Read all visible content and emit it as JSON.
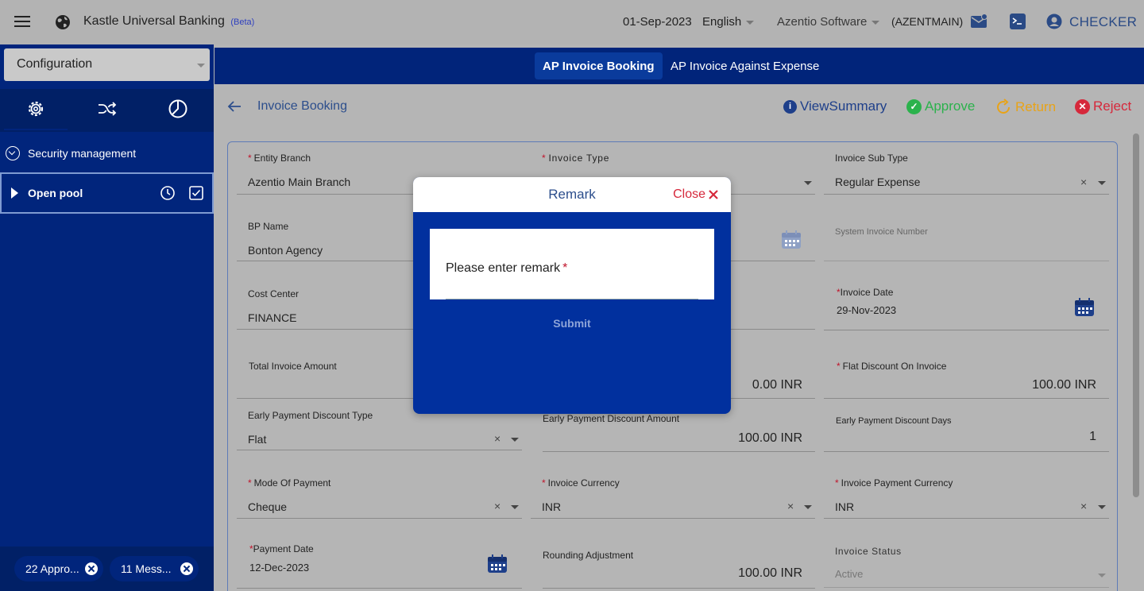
{
  "header": {
    "app_title": "Kastle Universal Banking",
    "beta": "(Beta)",
    "date": "01-Sep-2023",
    "language": "English",
    "organization": "Azentio Software",
    "org_code": "(AZENTMAIN)",
    "role": "CHECKER",
    "icons": [
      "menu-icon",
      "globe-icon",
      "mail-icon",
      "terminal-icon",
      "user-icon"
    ]
  },
  "sidebar": {
    "module_select": "Configuration",
    "tabs": [
      "gear-icon",
      "shuffle-icon",
      "pie-chart-icon"
    ],
    "tree": [
      {
        "label": "Security management",
        "icon": "circle-chevron-down-icon"
      },
      {
        "label": "Open pool",
        "icon": "triangle-right-icon"
      }
    ],
    "footer_chips": [
      {
        "label": "22 Appro..."
      },
      {
        "label": "11 Mess..."
      }
    ]
  },
  "tabs": [
    {
      "label": "AP Invoice Booking",
      "active": true
    },
    {
      "label": "AP Invoice Against Expense",
      "active": false
    }
  ],
  "page": {
    "title": "Invoice Booking",
    "actions": {
      "view_summary": "ViewSummary",
      "approve": "Approve",
      "return": "Return",
      "reject": "Reject"
    }
  },
  "form": {
    "entity_branch": {
      "label": "Entity Branch",
      "value": "Azentio Main Branch"
    },
    "invoice_type": {
      "label": "Invoice Type",
      "value": ""
    },
    "invoice_sub_type": {
      "label": "Invoice Sub Type",
      "value": "Regular Expense"
    },
    "bp_name": {
      "label": "BP Name",
      "value": "Bonton Agency"
    },
    "system_invoice_number": {
      "label": "System Invoice Number",
      "value": ""
    },
    "cost_center": {
      "label": "Cost Center",
      "value": "FINANCE"
    },
    "invoice_date": {
      "label": "Invoice Date",
      "value": "29-Nov-2023"
    },
    "total_invoice_amount": {
      "label": "Total Invoice Amount",
      "value": "0.00 INR"
    },
    "flat_discount": {
      "label": "Flat Discount On Invoice",
      "value": "100.00 INR"
    },
    "early_payment_discount_type": {
      "label": "Early Payment Discount Type",
      "value": "Flat"
    },
    "early_payment_discount_amount": {
      "label": "Early Payment Discount Amount",
      "value": "100.00 INR"
    },
    "early_payment_discount_days": {
      "label": "Early Payment Discount Days",
      "value": "1"
    },
    "mode_of_payment": {
      "label": "Mode Of Payment",
      "value": "Cheque"
    },
    "invoice_currency": {
      "label": "Invoice Currency",
      "value": "INR"
    },
    "invoice_payment_currency": {
      "label": "Invoice Payment Currency",
      "value": "INR"
    },
    "payment_date": {
      "label": "Payment Date",
      "value": "12-Dec-2023"
    },
    "rounding_adjustment": {
      "label": "Rounding Adjustment",
      "value": "100.00 INR"
    },
    "invoice_status": {
      "label": "Invoice Status",
      "value": "Active"
    }
  },
  "modal": {
    "title": "Remark",
    "close_label": "Close",
    "input_placeholder": "Please enter remark",
    "submit_label": "Submit"
  },
  "colors": {
    "sidebar_bg": "#01257c",
    "tabbar_bg": "#01247a",
    "modal_bg": "#01309e",
    "approve": "#2bb24c",
    "return": "#e8a317",
    "reject": "#d6283b",
    "view_summary": "#1e3f8a"
  }
}
